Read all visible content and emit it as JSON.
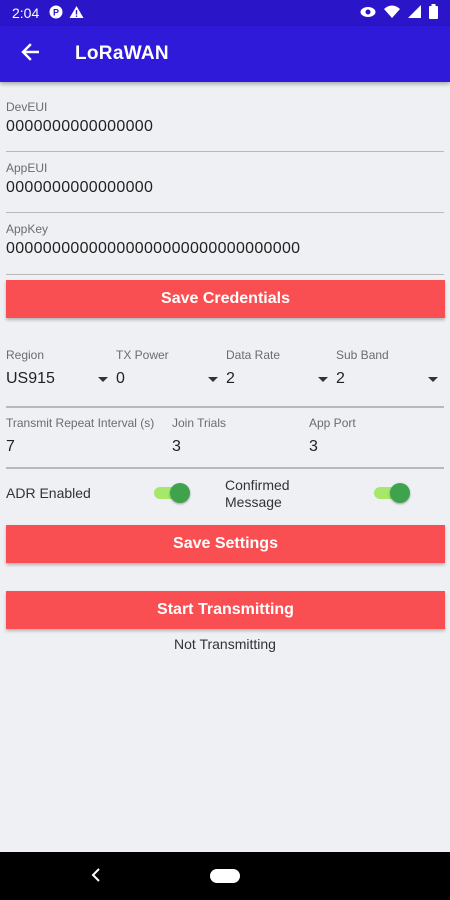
{
  "status_bar": {
    "time": "2:04",
    "icons": [
      "app-notification-icon",
      "warning-icon",
      "eye-icon",
      "wifi-icon",
      "signal-icon",
      "battery-icon"
    ]
  },
  "app_bar": {
    "title": "LoRaWAN",
    "back_icon": "arrow-back-icon"
  },
  "credentials": {
    "dev_eui": {
      "label": "DevEUI",
      "value": "0000000000000000"
    },
    "app_eui": {
      "label": "AppEUI",
      "value": "0000000000000000"
    },
    "app_key": {
      "label": "AppKey",
      "value": "00000000000000000000000000000000"
    },
    "save_label": "Save Credentials"
  },
  "settings": {
    "region": {
      "label": "Region",
      "value": "US915"
    },
    "tx_power": {
      "label": "TX Power",
      "value": "0"
    },
    "data_rate": {
      "label": "Data Rate",
      "value": "2"
    },
    "sub_band": {
      "label": "Sub Band",
      "value": "2"
    },
    "repeat_interval": {
      "label": "Transmit Repeat Interval (s)",
      "value": "7"
    },
    "join_trials": {
      "label": "Join Trials",
      "value": "3"
    },
    "app_port": {
      "label": "App Port",
      "value": "3"
    },
    "adr": {
      "label": "ADR Enabled",
      "enabled": true
    },
    "confirmed": {
      "label": "Confirmed Message",
      "enabled": true
    },
    "save_label": "Save Settings"
  },
  "transmit": {
    "button_label": "Start Transmitting",
    "status": "Not Transmitting"
  },
  "colors": {
    "primary": "#2e1ad8",
    "status_bar": "#2a16c8",
    "accent_button": "#fa4f52",
    "switch_track": "#a5e86a",
    "switch_thumb": "#3fa34d",
    "background": "#eff0f4"
  }
}
